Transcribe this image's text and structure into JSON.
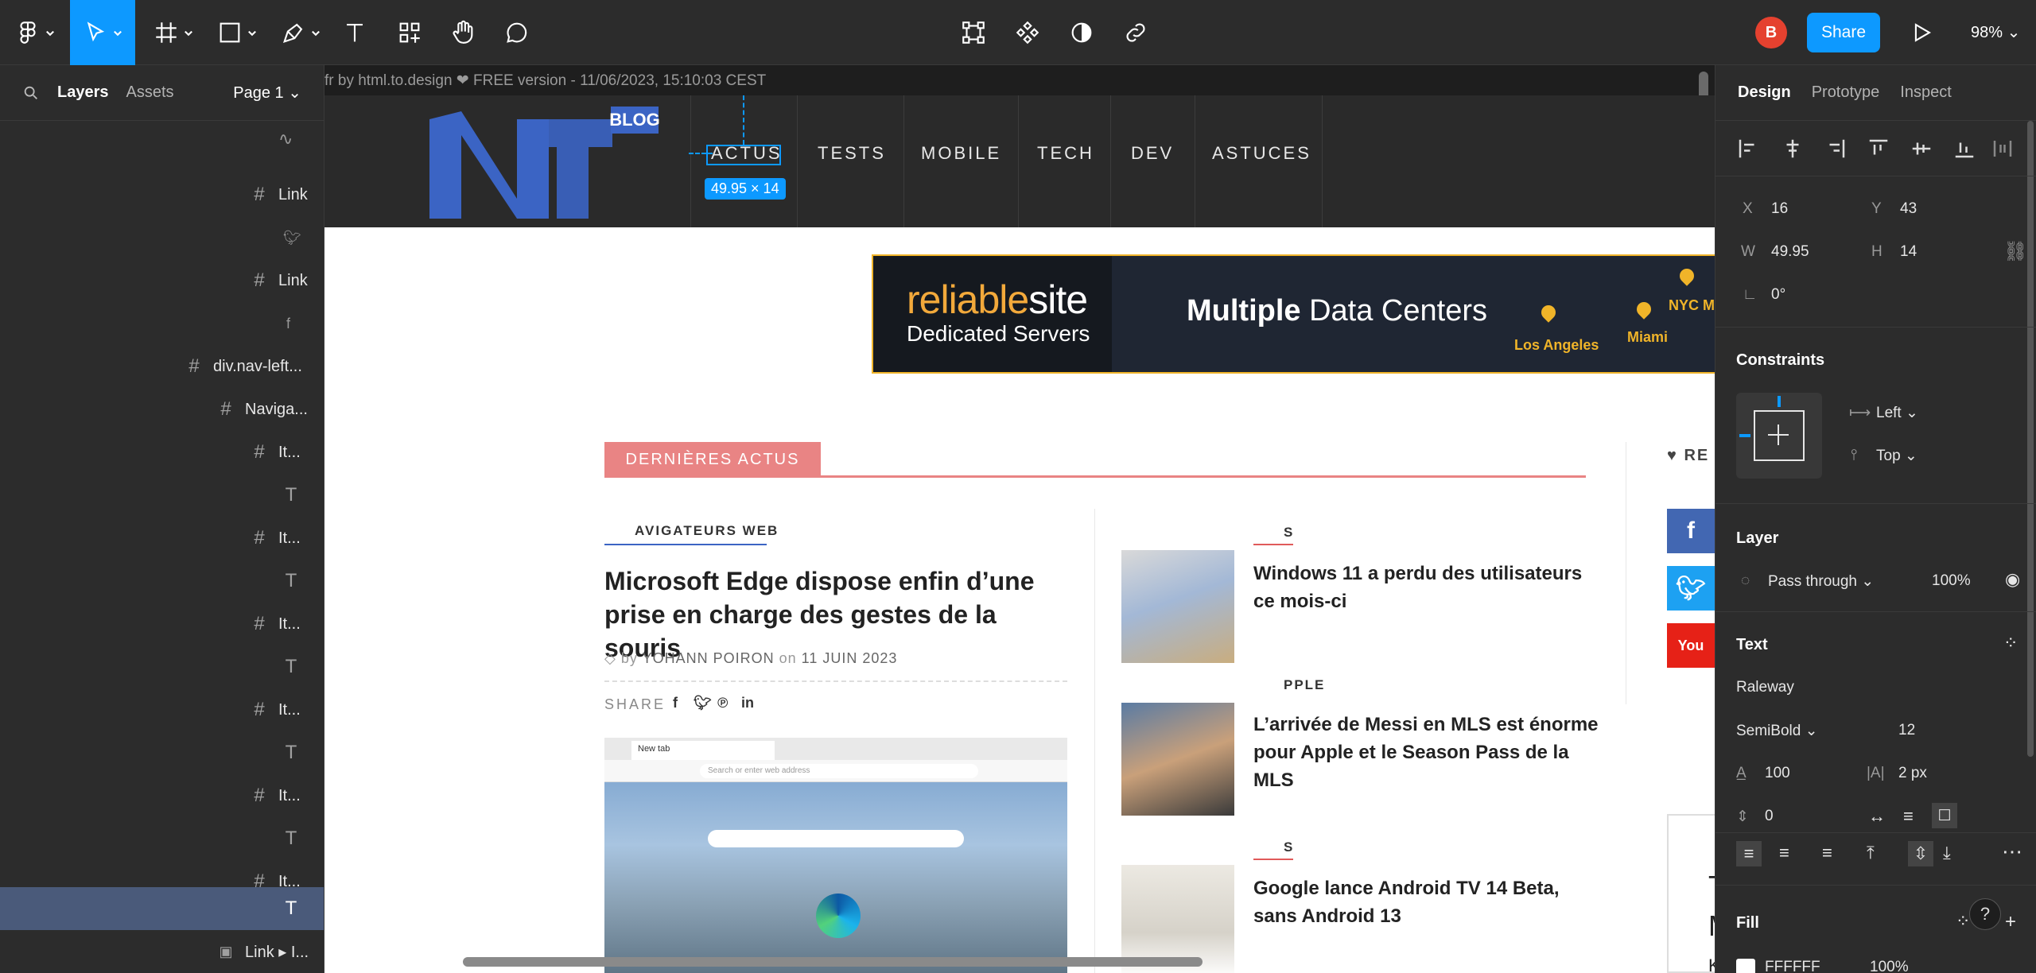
{
  "toolbar": {
    "share_label": "Share",
    "avatar_letter": "B",
    "zoom_level": "98%"
  },
  "left_panel": {
    "tab_layers": "Layers",
    "tab_assets": "Assets",
    "page_selector": "Page 1",
    "layers": [
      {
        "icon": "#",
        "label": "Link"
      },
      {
        "icon": "#",
        "label": "Link"
      },
      {
        "icon": "#",
        "label": "div.nav-left..."
      },
      {
        "icon": "#",
        "label": "Naviga..."
      },
      {
        "icon": "#",
        "label": "It..."
      },
      {
        "icon": "T",
        "label": ""
      },
      {
        "icon": "#",
        "label": "It..."
      },
      {
        "icon": "T",
        "label": ""
      },
      {
        "icon": "#",
        "label": "It..."
      },
      {
        "icon": "T",
        "label": ""
      },
      {
        "icon": "#",
        "label": "It..."
      },
      {
        "icon": "T",
        "label": ""
      },
      {
        "icon": "#",
        "label": "It..."
      },
      {
        "icon": "T",
        "label": ""
      },
      {
        "icon": "#",
        "label": "It..."
      },
      {
        "icon": "T",
        "label": ""
      },
      {
        "icon": "img",
        "label": "Link ▸ I..."
      }
    ]
  },
  "canvas": {
    "frame_label": "fr by html.to.design ❤ FREE version - 11/06/2023, 15:10:03 CEST",
    "site": {
      "blog_tag": "BLOG",
      "nav": [
        "ACTUS",
        "TESTS",
        "MOBILE",
        "TECH",
        "DEV",
        "ASTUCES"
      ],
      "selection_dims": "49.95 × 14",
      "banner": {
        "brand_colored": "reliable",
        "brand_white": "site",
        "subtitle": "Dedicated Servers",
        "headline_bold": "Multiple",
        "headline_rest": " Data Centers",
        "cities": [
          "Los Angeles",
          "Miami",
          "NYC M"
        ]
      },
      "section_tag": "DERNIÈRES ACTUS",
      "main_article": {
        "category": "AVIGATEURS WEB",
        "title": "Microsoft Edge dispose enfin d’une prise en charge des gestes de la souris",
        "by": "by",
        "author": "YOHANN POIRON",
        "on": "on",
        "date": "11 JUIN 2023",
        "share_label": "SHARE",
        "browser_tab": "New tab",
        "browser_search": "Search or enter web address"
      },
      "cards": [
        {
          "category": "S",
          "title": "Windows 11 a perdu des utilisateurs ce mois-ci"
        },
        {
          "category": "PPLE",
          "title": "L’arrivée de Messi en MLS est énorme pour Apple et le Season Pass de la MLS"
        },
        {
          "category": "S",
          "title": "Google lance Android TV 14 Beta, sans Android 13"
        }
      ],
      "sidebar_follow": "RE",
      "sidebar_box_letters": [
        "T",
        "M",
        "K"
      ]
    }
  },
  "right_panel": {
    "tabs": [
      "Design",
      "Prototype",
      "Inspect"
    ],
    "x_label": "X",
    "x_value": "16",
    "y_label": "Y",
    "y_value": "43",
    "w_label": "W",
    "w_value": "49.95",
    "h_label": "H",
    "h_value": "14",
    "rotation": "0°",
    "constraints_title": "Constraints",
    "constraint_h": "Left",
    "constraint_v": "Top",
    "layer_title": "Layer",
    "blend_mode": "Pass through",
    "opacity": "100%",
    "text_title": "Text",
    "font_family": "Raleway",
    "font_weight": "SemiBold",
    "font_size": "12",
    "line_height": "100",
    "letter_spacing": "2 px",
    "paragraph_spacing": "0",
    "fill_title": "Fill",
    "fill_hex": "FFFFFF",
    "fill_opacity": "100%"
  },
  "colors": {
    "accent": "#0d99ff",
    "site_header": "#2a2a2a",
    "section_red": "#e98484",
    "blog_blue": "#3b64c4",
    "banner_gold": "#f0b429"
  }
}
